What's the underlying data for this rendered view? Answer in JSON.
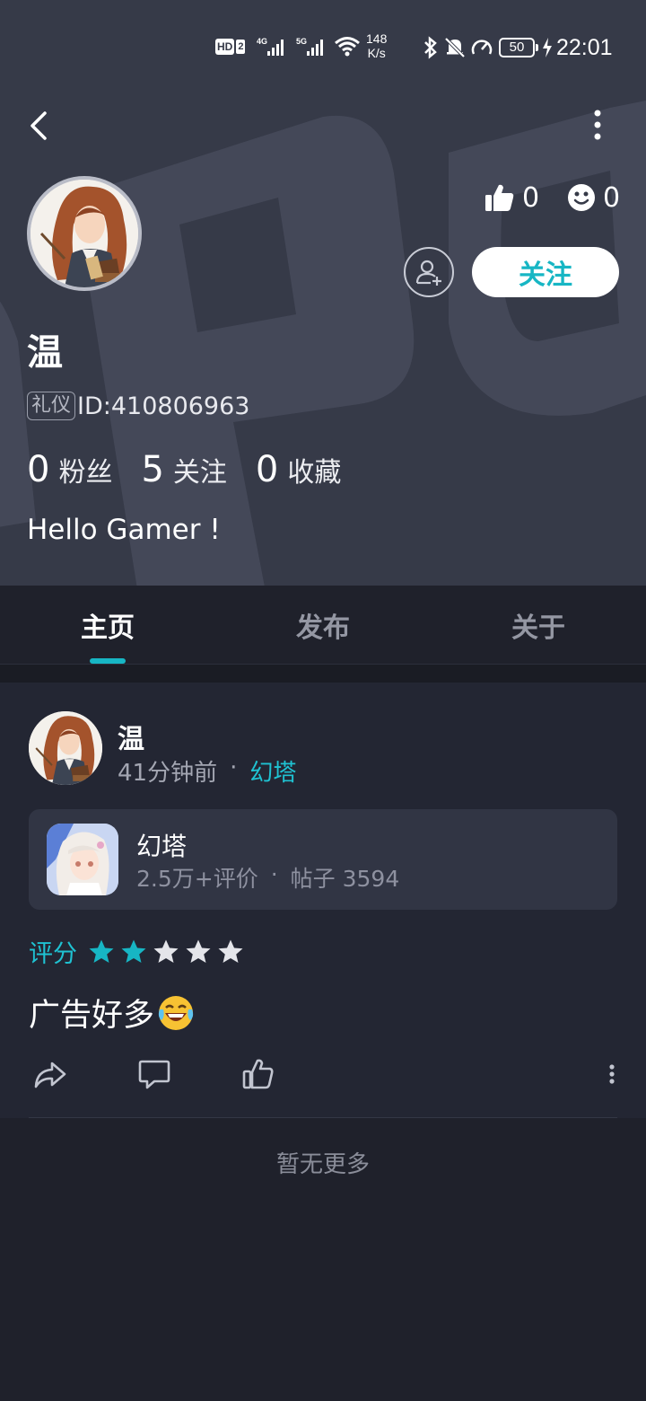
{
  "status_bar": {
    "hd": "HD",
    "sim": "2",
    "net1": "4G",
    "net2": "5G",
    "speed_value": "148",
    "speed_unit": "K/s",
    "battery": "50",
    "time": "22:01"
  },
  "profile": {
    "name": "温",
    "badge": "礼仪",
    "id_text": "ID:410806963",
    "likes": "0",
    "reactions": "0",
    "follow_label": "关注",
    "bio": "Hello Gamer !",
    "stats": [
      {
        "value": "0",
        "label": "粉丝"
      },
      {
        "value": "5",
        "label": "关注"
      },
      {
        "value": "0",
        "label": "收藏"
      }
    ]
  },
  "tabs": [
    {
      "label": "主页",
      "active": true
    },
    {
      "label": "发布",
      "active": false
    },
    {
      "label": "关于",
      "active": false
    }
  ],
  "post": {
    "author": "温",
    "time": "41分钟前",
    "separator": "·",
    "game_tag": "幻塔",
    "game": {
      "name": "幻塔",
      "reviews": "2.5万+评价",
      "posts": "帖子 3594"
    },
    "rating_label": "评分",
    "rating": 2,
    "rating_max": 5,
    "text": "广告好多",
    "emoji": "😂"
  },
  "footer": {
    "no_more": "暂无更多"
  },
  "colors": {
    "accent": "#17b6c4",
    "header_bg": "#363a48",
    "page_bg": "#1f212b",
    "card_bg": "#232633"
  },
  "icons": [
    "back-icon",
    "more-vertical-icon",
    "thumbs-up-icon",
    "smile-icon",
    "add-friend-icon",
    "share-icon",
    "comment-icon",
    "like-icon",
    "star-icon"
  ]
}
